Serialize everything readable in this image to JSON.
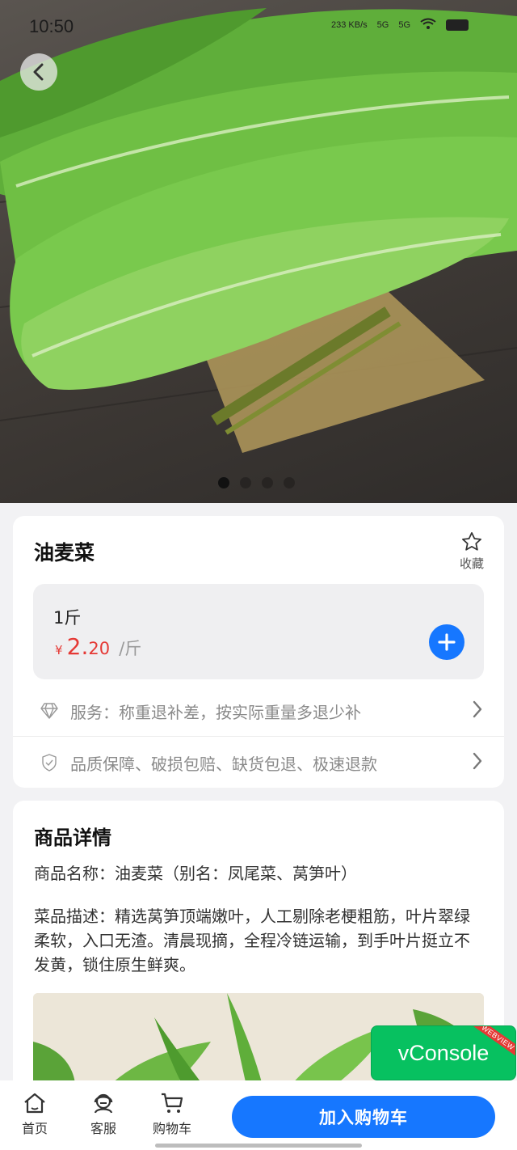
{
  "status_bar": {
    "time": "10:50",
    "net_speed": "233 KB/s",
    "signal_1": "5G",
    "signal_2": "5G"
  },
  "product": {
    "name": "油麦菜",
    "favorite_label": "收藏",
    "spec_unit": "1斤",
    "price_symbol": "¥",
    "price_integer": "2.",
    "price_decimal": "20",
    "price_per": "/斤"
  },
  "carousel": {
    "total": 4,
    "active_index": 0
  },
  "service_rows": [
    {
      "icon": "diamond-icon",
      "text": "服务：称重退补差，按实际重量多退少补"
    },
    {
      "icon": "shield-check-icon",
      "text": "品质保障、破损包赔、缺货包退、极速退款"
    }
  ],
  "details": {
    "title": "商品详情",
    "name_line": "商品名称：油麦菜（别名：凤尾菜、莴笋叶）",
    "description": "菜品描述：精选莴笋顶端嫩叶，人工剔除老梗粗筋，叶片翠绿柔软，入口无渣。清晨现摘，全程冷链运输，到手叶片挺立不发黄，锁住原生鲜爽。"
  },
  "vconsole": {
    "label": "vConsole",
    "ribbon": "WEBVIEW"
  },
  "bottom_nav": {
    "home": "首页",
    "service": "客服",
    "cart": "购物车",
    "add_to_cart": "加入购物车"
  },
  "colors": {
    "accent": "#1677ff",
    "price": "#e53935",
    "vconsole": "#07c160"
  }
}
